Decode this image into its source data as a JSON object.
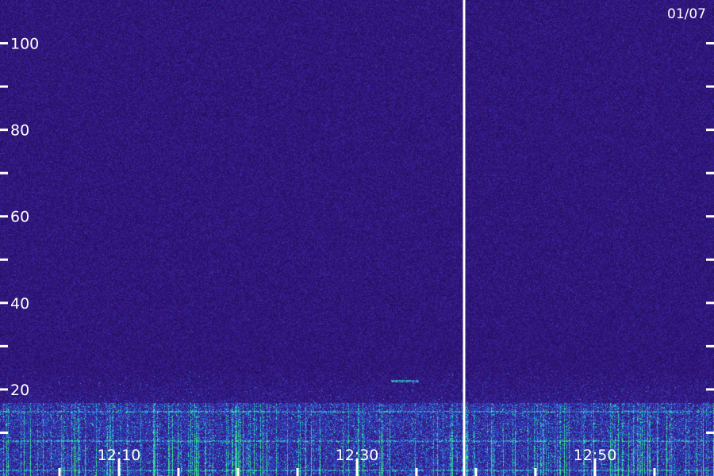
{
  "chart_data": {
    "type": "heatmap",
    "title": "",
    "date": "01/07",
    "y_axis": {
      "range": [
        0,
        110
      ],
      "major_ticks": [
        20,
        40,
        60,
        80,
        100
      ],
      "major_labels": [
        "20",
        "40",
        "60",
        "80",
        "100"
      ],
      "minor_ticks": [
        10,
        30,
        50,
        70,
        90
      ]
    },
    "x_axis": {
      "start": "12:00",
      "end": "13:00",
      "labeled_ticks": [
        "12:10",
        "12:30",
        "12:50"
      ],
      "minor_tick_minutes": 5
    },
    "segment_break": "12:39",
    "features": [
      {
        "kind": "broadband-band",
        "from": 0,
        "to": 17
      },
      {
        "kind": "narrowband-line",
        "time": "12:34",
        "value": 22
      }
    ],
    "colors": {
      "background": "#3a1a8c",
      "low": "#2a1270",
      "mid": "#2f5ce0",
      "high": "#28d8e0",
      "peak": "#3cf070",
      "axis": "#ffffff"
    }
  }
}
